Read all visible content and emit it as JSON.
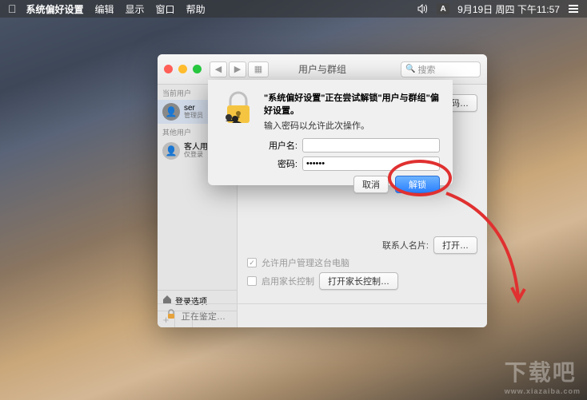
{
  "menubar": {
    "app": "系统偏好设置",
    "items": [
      "编辑",
      "显示",
      "窗口",
      "帮助"
    ],
    "ime": "A",
    "datetime": "9月19日 周四 下午11:57"
  },
  "window": {
    "title": "用户与群组",
    "search_placeholder": "搜索",
    "sidebar": {
      "section_current": "当前用户",
      "current": {
        "name": "ser",
        "role": "管理员"
      },
      "section_other": "其他用户",
      "guest": {
        "name": "客人用户",
        "role": "仅登录"
      },
      "login_options": "登录选项"
    },
    "main": {
      "change_password": "改密码…",
      "contact_label": "联系人名片:",
      "open_btn": "打开…",
      "allow_admin": "允许用户管理这台电脑",
      "parental_label": "启用家长控制",
      "parental_btn": "打开家长控制…"
    },
    "lock_text": "正在鉴定…"
  },
  "sheet": {
    "title": "\"系统偏好设置\"正在尝试解锁\"用户与群组\"偏好设置。",
    "subtitle": "输入密码以允许此次操作。",
    "user_label": "用户名:",
    "user_value": "",
    "pass_label": "密码:",
    "pass_value": "••••••",
    "cancel": "取消",
    "unlock": "解锁"
  },
  "watermark": {
    "main": "下载吧",
    "sub": "www.xiazaiba.com"
  }
}
